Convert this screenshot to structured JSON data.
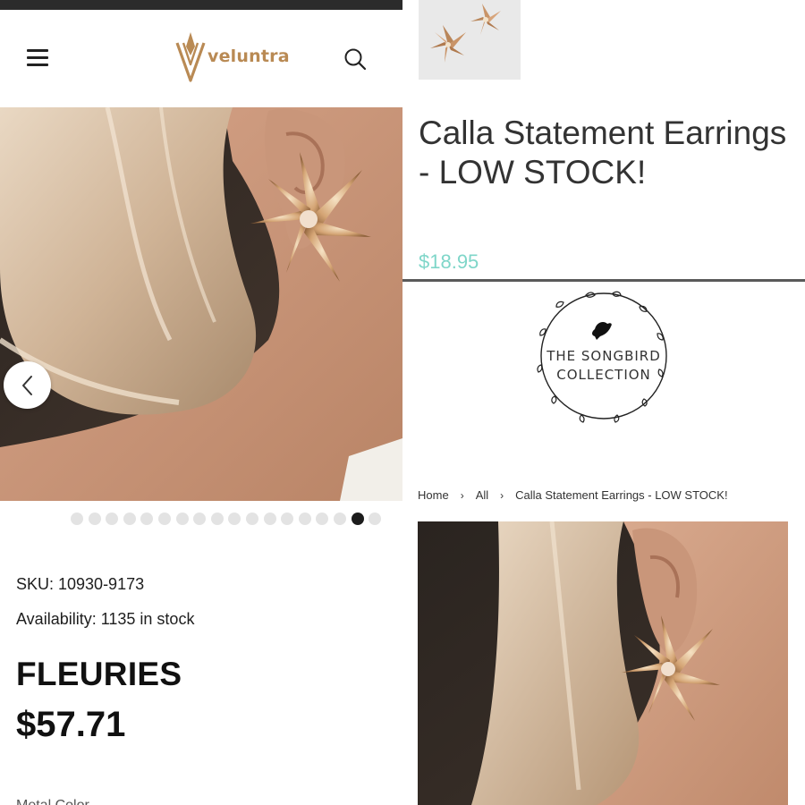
{
  "store": {
    "brand_name": "veluntra",
    "sku_text": "SKU: 10930-9173",
    "availability_text": "Availability: 1135 in stock",
    "product_name": "FLEURIES",
    "product_price": "$57.71",
    "carousel": {
      "total_slides": 18,
      "active_index": 16
    },
    "cut_off_text": "Metal Color"
  },
  "songbird": {
    "logo_line1": "THE SONGBIRD",
    "logo_line2": "COLLECTION",
    "product_title": "Calla Statement Earrings - LOW STOCK!",
    "price": "$18.95",
    "breadcrumb": [
      "Home",
      "All",
      "Calla Statement Earrings - LOW STOCK!"
    ],
    "breadcrumb_separator": "›"
  },
  "colors": {
    "brand_gold": "#b98a54",
    "price_teal": "#7fd6c9",
    "topbar": "#2b2b2b"
  },
  "icons": [
    "menu-icon",
    "search-icon",
    "chevron-left-icon",
    "bird-icon"
  ]
}
